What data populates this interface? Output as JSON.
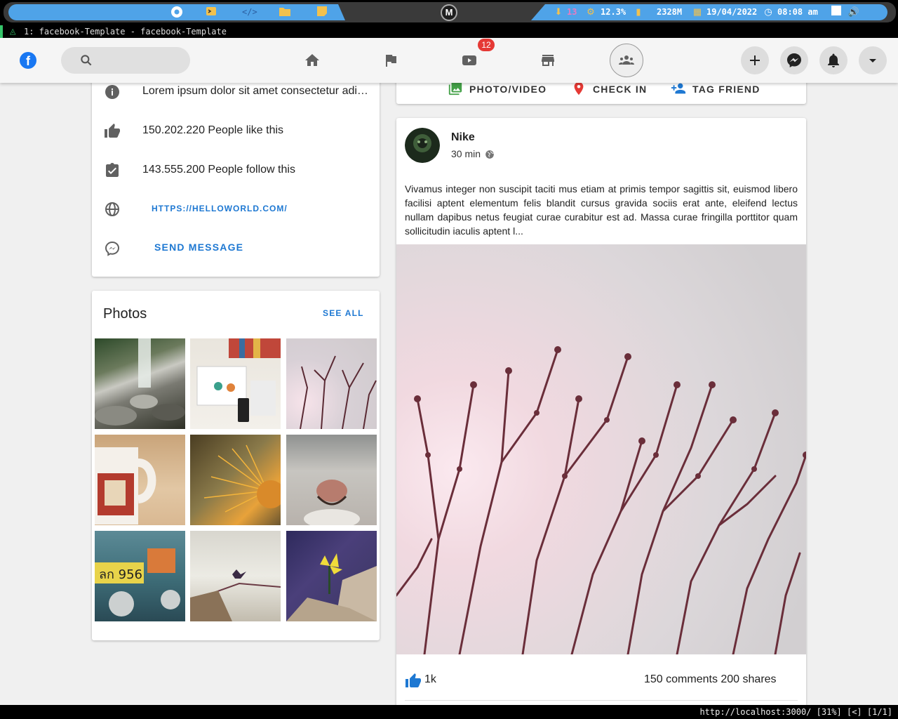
{
  "system_bar": {
    "downloads": "13",
    "cpu": "12.3%",
    "memory": "2328M",
    "date": "19/04/2022",
    "time": "08:08 am",
    "icons": [
      "chrome-icon",
      "terminal-icon",
      "code-icon",
      "folder-icon",
      "notes-icon",
      "downloads-icon",
      "cpu-icon",
      "memory-icon",
      "calendar-icon",
      "clock-icon",
      "window-icon",
      "volume-icon"
    ]
  },
  "terminal": {
    "title": "1: facebook-Template - facebook-Template"
  },
  "header": {
    "watch_badge": "12",
    "accent": "#1877f2",
    "icons": [
      "facebook-logo-icon",
      "search-icon",
      "home-icon",
      "flag-icon",
      "video-icon",
      "store-icon",
      "groups-icon",
      "add-icon",
      "messenger-icon",
      "bell-icon",
      "dropdown-icon"
    ]
  },
  "info": {
    "about": "Lorem ipsum dolor sit amet consectetur adipisicing elit",
    "likes": "150.202.220 People like this",
    "follows": "143.555.200 People follow this",
    "website": "HTTPS://HELLOWORLD.COM/",
    "send_message": "SEND MESSAGE"
  },
  "photos": {
    "title": "Photos",
    "see_all": "SEE ALL",
    "items": [
      "waterfall",
      "desk",
      "branches",
      "mug",
      "cactus",
      "cat-nose",
      "tuk-tuk",
      "pier",
      "flower"
    ]
  },
  "composer": {
    "photo_video": "PHOTO/VIDEO",
    "check_in": "CHECK IN",
    "tag_friend": "TAG FRIEND"
  },
  "post": {
    "author": "Nike",
    "time": "30 min",
    "text": "Vivamus integer non suscipit taciti mus etiam at primis tempor sagittis sit, euismod libero facilisi aptent elementum felis blandit cursus gravida sociis erat ante, eleifend lectus nullam dapibus netus feugiat curae curabitur est ad. Massa curae fringilla porttitor quam sollicitudin iaculis aptent l...",
    "likes": "1k",
    "comments_shares": "150 comments 200 shares"
  },
  "status": {
    "url": "http://localhost:3000/ [31%] [<] [1/1]"
  }
}
